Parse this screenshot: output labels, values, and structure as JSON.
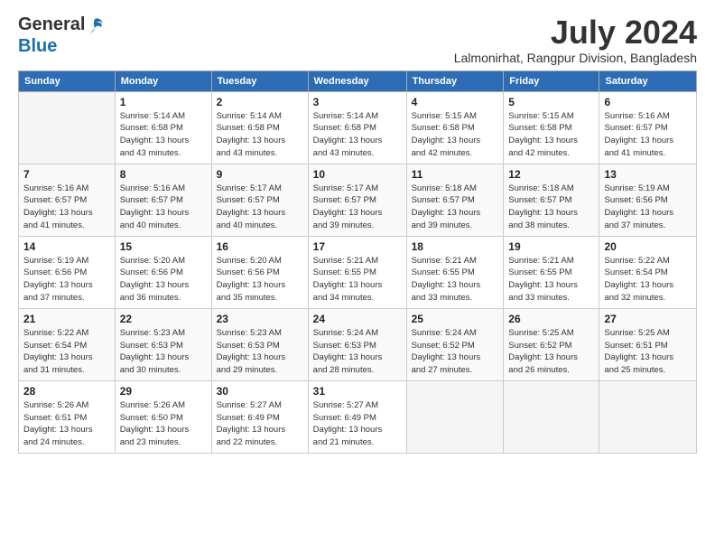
{
  "header": {
    "logo_line1": "General",
    "logo_line2": "Blue",
    "month": "July 2024",
    "location": "Lalmonirhat, Rangpur Division, Bangladesh"
  },
  "weekdays": [
    "Sunday",
    "Monday",
    "Tuesday",
    "Wednesday",
    "Thursday",
    "Friday",
    "Saturday"
  ],
  "weeks": [
    [
      {
        "day": "",
        "info": ""
      },
      {
        "day": "1",
        "info": "Sunrise: 5:14 AM\nSunset: 6:58 PM\nDaylight: 13 hours\nand 43 minutes."
      },
      {
        "day": "2",
        "info": "Sunrise: 5:14 AM\nSunset: 6:58 PM\nDaylight: 13 hours\nand 43 minutes."
      },
      {
        "day": "3",
        "info": "Sunrise: 5:14 AM\nSunset: 6:58 PM\nDaylight: 13 hours\nand 43 minutes."
      },
      {
        "day": "4",
        "info": "Sunrise: 5:15 AM\nSunset: 6:58 PM\nDaylight: 13 hours\nand 42 minutes."
      },
      {
        "day": "5",
        "info": "Sunrise: 5:15 AM\nSunset: 6:58 PM\nDaylight: 13 hours\nand 42 minutes."
      },
      {
        "day": "6",
        "info": "Sunrise: 5:16 AM\nSunset: 6:57 PM\nDaylight: 13 hours\nand 41 minutes."
      }
    ],
    [
      {
        "day": "7",
        "info": "Sunrise: 5:16 AM\nSunset: 6:57 PM\nDaylight: 13 hours\nand 41 minutes."
      },
      {
        "day": "8",
        "info": "Sunrise: 5:16 AM\nSunset: 6:57 PM\nDaylight: 13 hours\nand 40 minutes."
      },
      {
        "day": "9",
        "info": "Sunrise: 5:17 AM\nSunset: 6:57 PM\nDaylight: 13 hours\nand 40 minutes."
      },
      {
        "day": "10",
        "info": "Sunrise: 5:17 AM\nSunset: 6:57 PM\nDaylight: 13 hours\nand 39 minutes."
      },
      {
        "day": "11",
        "info": "Sunrise: 5:18 AM\nSunset: 6:57 PM\nDaylight: 13 hours\nand 39 minutes."
      },
      {
        "day": "12",
        "info": "Sunrise: 5:18 AM\nSunset: 6:57 PM\nDaylight: 13 hours\nand 38 minutes."
      },
      {
        "day": "13",
        "info": "Sunrise: 5:19 AM\nSunset: 6:56 PM\nDaylight: 13 hours\nand 37 minutes."
      }
    ],
    [
      {
        "day": "14",
        "info": "Sunrise: 5:19 AM\nSunset: 6:56 PM\nDaylight: 13 hours\nand 37 minutes."
      },
      {
        "day": "15",
        "info": "Sunrise: 5:20 AM\nSunset: 6:56 PM\nDaylight: 13 hours\nand 36 minutes."
      },
      {
        "day": "16",
        "info": "Sunrise: 5:20 AM\nSunset: 6:56 PM\nDaylight: 13 hours\nand 35 minutes."
      },
      {
        "day": "17",
        "info": "Sunrise: 5:21 AM\nSunset: 6:55 PM\nDaylight: 13 hours\nand 34 minutes."
      },
      {
        "day": "18",
        "info": "Sunrise: 5:21 AM\nSunset: 6:55 PM\nDaylight: 13 hours\nand 33 minutes."
      },
      {
        "day": "19",
        "info": "Sunrise: 5:21 AM\nSunset: 6:55 PM\nDaylight: 13 hours\nand 33 minutes."
      },
      {
        "day": "20",
        "info": "Sunrise: 5:22 AM\nSunset: 6:54 PM\nDaylight: 13 hours\nand 32 minutes."
      }
    ],
    [
      {
        "day": "21",
        "info": "Sunrise: 5:22 AM\nSunset: 6:54 PM\nDaylight: 13 hours\nand 31 minutes."
      },
      {
        "day": "22",
        "info": "Sunrise: 5:23 AM\nSunset: 6:53 PM\nDaylight: 13 hours\nand 30 minutes."
      },
      {
        "day": "23",
        "info": "Sunrise: 5:23 AM\nSunset: 6:53 PM\nDaylight: 13 hours\nand 29 minutes."
      },
      {
        "day": "24",
        "info": "Sunrise: 5:24 AM\nSunset: 6:53 PM\nDaylight: 13 hours\nand 28 minutes."
      },
      {
        "day": "25",
        "info": "Sunrise: 5:24 AM\nSunset: 6:52 PM\nDaylight: 13 hours\nand 27 minutes."
      },
      {
        "day": "26",
        "info": "Sunrise: 5:25 AM\nSunset: 6:52 PM\nDaylight: 13 hours\nand 26 minutes."
      },
      {
        "day": "27",
        "info": "Sunrise: 5:25 AM\nSunset: 6:51 PM\nDaylight: 13 hours\nand 25 minutes."
      }
    ],
    [
      {
        "day": "28",
        "info": "Sunrise: 5:26 AM\nSunset: 6:51 PM\nDaylight: 13 hours\nand 24 minutes."
      },
      {
        "day": "29",
        "info": "Sunrise: 5:26 AM\nSunset: 6:50 PM\nDaylight: 13 hours\nand 23 minutes."
      },
      {
        "day": "30",
        "info": "Sunrise: 5:27 AM\nSunset: 6:49 PM\nDaylight: 13 hours\nand 22 minutes."
      },
      {
        "day": "31",
        "info": "Sunrise: 5:27 AM\nSunset: 6:49 PM\nDaylight: 13 hours\nand 21 minutes."
      },
      {
        "day": "",
        "info": ""
      },
      {
        "day": "",
        "info": ""
      },
      {
        "day": "",
        "info": ""
      }
    ]
  ]
}
